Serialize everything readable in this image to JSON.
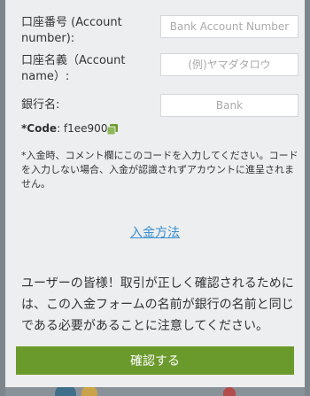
{
  "form": {
    "account_number": {
      "label": "口座番号 (Account number):",
      "placeholder": "Bank Account Number"
    },
    "account_name": {
      "label": "口座名義（Account name）:",
      "placeholder": "(例)ヤマダタロウ"
    },
    "bank_name": {
      "label": "銀行名:",
      "placeholder": "Bank"
    },
    "code": {
      "prefix": "*Code",
      "value": ": f1ee900"
    },
    "note": "*入金時、コメント欄にこのコードを入力してください。コードを入力しない場合、入金が認識されずアカウントに進呈されません。",
    "deposit_method_link": "入金方法",
    "warning": "ユーザーの皆様！取引が正しく確認されるためには、この入金フォームの名前が銀行の名前と同じである必要があることに注意してください。",
    "confirm_button": "確認する"
  },
  "colors": {
    "accent_button": "#6b9a2c",
    "link": "#3a8fcf"
  }
}
